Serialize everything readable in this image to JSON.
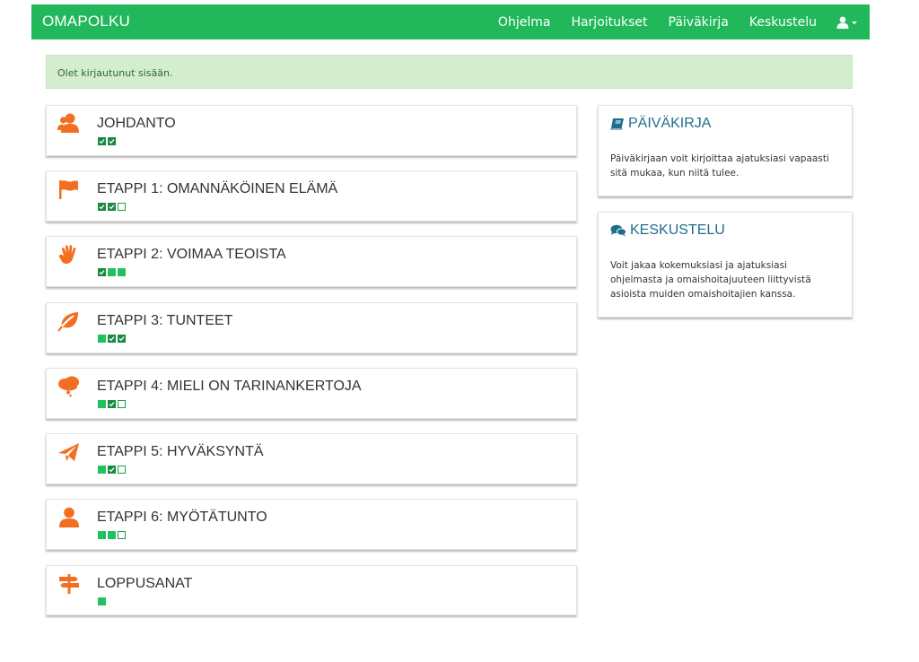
{
  "navbar": {
    "brand": "OMAPOLKU",
    "links": [
      "Ohjelma",
      "Harjoitukset",
      "Päiväkirja",
      "Keskustelu"
    ],
    "user_icon": "user-icon"
  },
  "alert": {
    "text": "Olet kirjautunut sisään."
  },
  "modules": [
    {
      "title": "JOHDANTO",
      "icon": "users-icon",
      "progress": [
        "done",
        "done"
      ]
    },
    {
      "title": "ETAPPI 1: OMANNÄKÖINEN ELÄMÄ",
      "icon": "flag-icon",
      "progress": [
        "done",
        "done",
        "empty"
      ]
    },
    {
      "title": "ETAPPI 2: VOIMAA TEOISTA",
      "icon": "hand-icon",
      "progress": [
        "done",
        "current",
        "current"
      ]
    },
    {
      "title": "ETAPPI 3: TUNTEET",
      "icon": "leaf-icon",
      "progress": [
        "current",
        "done",
        "done"
      ]
    },
    {
      "title": "ETAPPI 4: MIELI ON TARINANKERTOJA",
      "icon": "thought-cloud-icon",
      "progress": [
        "current",
        "done",
        "empty"
      ]
    },
    {
      "title": "ETAPPI 5: HYVÄKSYNTÄ",
      "icon": "paper-plane-icon",
      "progress": [
        "current",
        "done",
        "empty"
      ]
    },
    {
      "title": "ETAPPI 6: MYÖTÄTUNTO",
      "icon": "person-icon",
      "progress": [
        "current",
        "current",
        "empty"
      ]
    },
    {
      "title": "LOPPUSANAT",
      "icon": "signpost-icon",
      "progress": [
        "current"
      ]
    }
  ],
  "sidebar": {
    "diary": {
      "title": "PÄIVÄKIRJA",
      "icon": "book-icon",
      "text": "Päiväkirjaan voit kirjoittaa ajatuksiasi vapaasti sitä mukaa, kun niitä tulee."
    },
    "chat": {
      "title": "KESKUSTELU",
      "icon": "comments-icon",
      "text": "Voit jakaa kokemuksiasi ja ajatuksiasi ohjelmasta ja omaishoitajuuteen liittyvistä asioista muiden omaishoitajien kanssa."
    }
  },
  "colors": {
    "navbar": "#20b85b",
    "icon": "#f26f21",
    "progress_done": "#1a8a42",
    "progress_current": "#21c25e",
    "side_title": "#1f6d8c"
  }
}
